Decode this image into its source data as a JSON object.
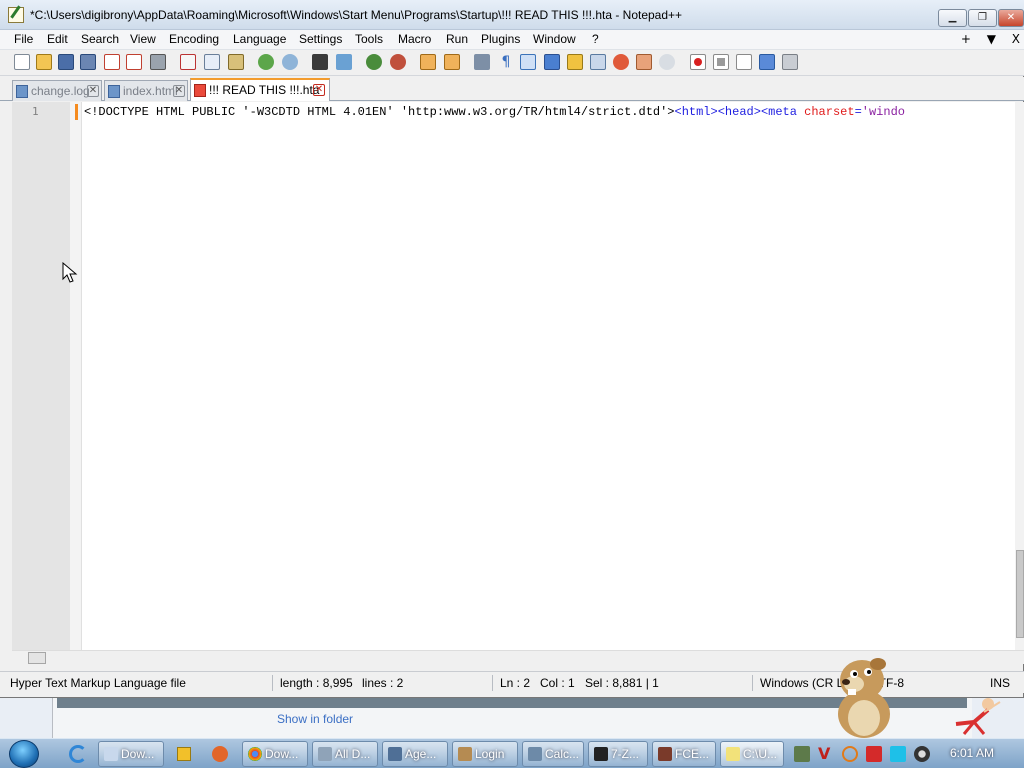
{
  "window": {
    "title": "*C:\\Users\\digibrony\\AppData\\Roaming\\Microsoft\\Windows\\Start Menu\\Programs\\Startup\\!!! READ THIS !!!.hta - Notepad++",
    "min_label": "▁",
    "max_label": "❐",
    "close_label": "✕"
  },
  "menu": {
    "items": [
      "File",
      "Edit",
      "Search",
      "View",
      "Encoding",
      "Language",
      "Settings",
      "Tools",
      "Macro",
      "Run",
      "Plugins",
      "Window",
      "?"
    ],
    "right_plus": "+",
    "right_down": "▼",
    "right_x": "X"
  },
  "toolbar": {
    "icons": [
      "new-file-icon",
      "open-file-icon",
      "save-icon",
      "save-all-icon",
      "close-icon",
      "close-all-icon",
      "print-icon",
      "cut-icon",
      "copy-icon",
      "paste-icon",
      "undo-icon",
      "redo-icon",
      "find-icon",
      "replace-icon",
      "zoom-in-icon",
      "zoom-out-icon",
      "sync-vertical-icon",
      "sync-horizontal-icon",
      "word-wrap-icon",
      "show-all-chars-icon",
      "indent-guide-icon",
      "user-lang-icon",
      "doc-map-icon",
      "function-list-icon",
      "folder-workspace-icon",
      "monitoring-icon",
      "record-macro-icon",
      "stop-macro-icon",
      "play-macro-icon",
      "play-multiple-icon",
      "save-macro-icon"
    ]
  },
  "tabs": [
    {
      "label": "change.log",
      "close": "✕"
    },
    {
      "label": "index.html",
      "close": "✕"
    },
    {
      "label": "!!! READ THIS !!!.hta",
      "close": "✕"
    }
  ],
  "editor": {
    "line_number": "1",
    "code": {
      "doctype": "<!DOCTYPE HTML PUBLIC '-W3CDTD HTML 4.01EN' 'http:www.w3.org/TR/html4/strict.dtd'>",
      "tag1": "<html>",
      "tag2": "<head>",
      "tag3": "<meta ",
      "attr": "charset",
      "eq": "=",
      "val": "'windo"
    }
  },
  "status": {
    "file_type": "Hyper Text Markup Language file",
    "length": "length : 8,995",
    "lines": "lines : 2",
    "ln": "Ln : 2",
    "col": "Col : 1",
    "sel": "Sel : 8,881 | 1",
    "eol": "Windows (CR LF)",
    "encoding": "UTF-8",
    "ins": "INS"
  },
  "background_window": {
    "show_in_folder": "Show in folder"
  },
  "taskbar": {
    "buttons": [
      {
        "label": "Dow...",
        "color": "#c8d8ec"
      },
      {
        "label": "Dow...",
        "color": "#e8b13a"
      },
      {
        "label": "All D...",
        "color": "#8fa3b8"
      },
      {
        "label": "Age...",
        "color": "#4f6f96"
      },
      {
        "label": "Login",
        "color": "#b58b52"
      },
      {
        "label": "Calc...",
        "color": "#6d8aa8"
      },
      {
        "label": "7-Z...",
        "color": "#222222"
      },
      {
        "label": "FCE...",
        "color": "#7a3a2a"
      },
      {
        "label": "C:\\U...",
        "color": "#f2e27a"
      }
    ],
    "clock": "6:01 AM"
  },
  "colors": {
    "tag": "#1f1fe0",
    "attr": "#e01b1b",
    "value": "#8a1fa0",
    "active_tab_accent": "#f39c2e"
  }
}
